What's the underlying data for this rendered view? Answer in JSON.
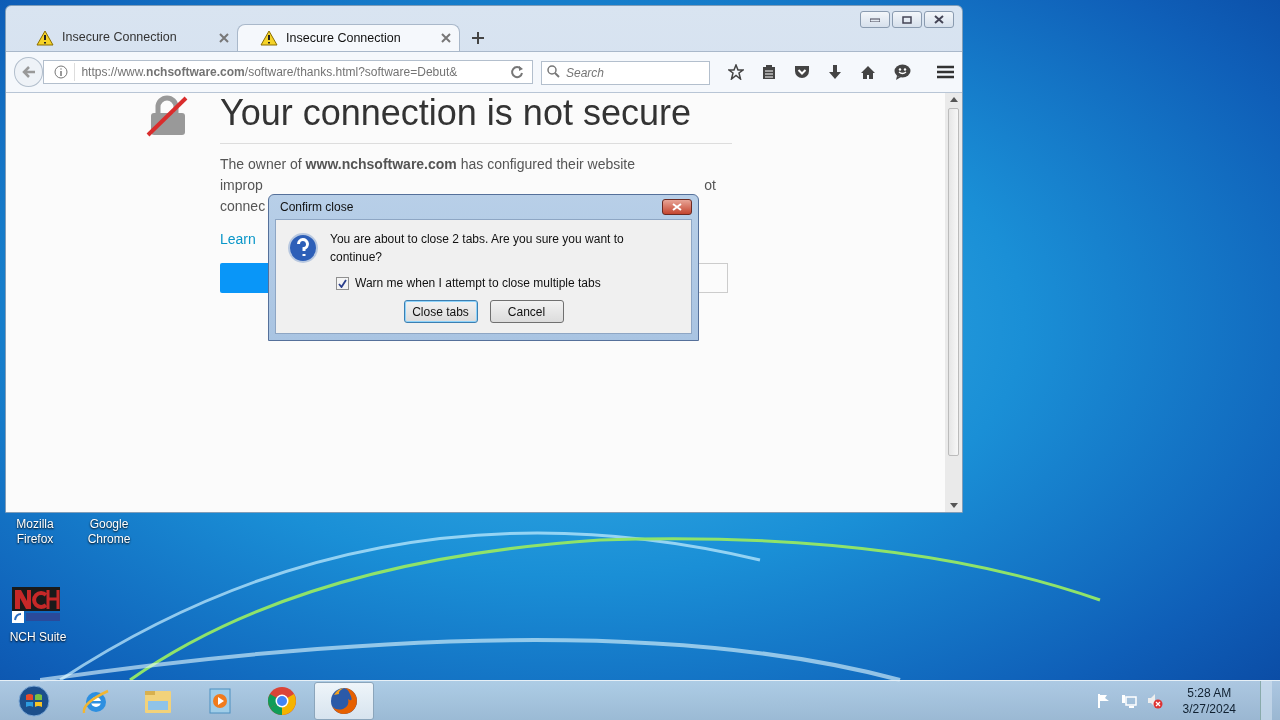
{
  "browser": {
    "tabs": [
      {
        "title": "Insecure Connection",
        "selected": false
      },
      {
        "title": "Insecure Connection",
        "selected": true
      }
    ],
    "url": "https://www.**nchsoftware.com**/software/thanks.html?software=Debut&",
    "search": {
      "placeholder": "Search"
    },
    "page": {
      "heading": "Your connection is not secure",
      "line_1": "The owner of **www.nchsoftware.com** has configured their website",
      "line_2_start": "improp",
      "line_2_end": "ot",
      "line_3": "connec",
      "link": "Learn"
    }
  },
  "dialog": {
    "title": "Confirm close",
    "message": "You are about to close 2 tabs. Are you sure you want to continue?",
    "checkbox": {
      "label": "Warn me when I attempt to close multiple tabs",
      "checked": true
    },
    "buttons": [
      {
        "label": "Close tabs",
        "default": true
      },
      {
        "label": "Cancel",
        "default": false
      }
    ]
  },
  "desktop_icons": [
    {
      "kind": "label-only",
      "label": "Mozilla Firefox"
    },
    {
      "kind": "label-only",
      "label": "Google Chrome"
    },
    {
      "kind": "nch",
      "label": "NCH Suite"
    }
  ],
  "taskbar": {
    "apps": [
      {
        "kind": "start",
        "selected": false
      },
      {
        "kind": "ie",
        "selected": false
      },
      {
        "kind": "explorer",
        "selected": false
      },
      {
        "kind": "media",
        "selected": false
      },
      {
        "kind": "chrome",
        "selected": false
      },
      {
        "kind": "firefox",
        "selected": true
      }
    ],
    "clock": {
      "time": "5:28 AM",
      "date": "3/27/2024"
    }
  }
}
